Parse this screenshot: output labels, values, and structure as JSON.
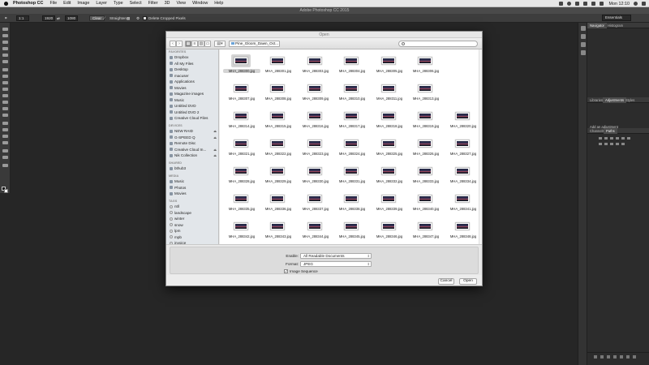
{
  "menubar": {
    "app_name": "Photoshop CC",
    "items": [
      "File",
      "Edit",
      "Image",
      "Layer",
      "Type",
      "Select",
      "Filter",
      "3D",
      "View",
      "Window",
      "Help"
    ],
    "clock": "Mon 12:10"
  },
  "ps": {
    "window_title": "Adobe Photoshop CC 2015",
    "options": {
      "ratio_value": "1:1",
      "width_value": "1920",
      "height_value": "1080",
      "clear_label": "Clear",
      "straighten_label": "Straighten",
      "delete_cropped_label": "Delete Cropped Pixels"
    },
    "workspace": "Essentials"
  },
  "panels": {
    "top_tabs": [
      "Navigator",
      "Histogram"
    ],
    "mid_tabs": [
      "Libraries",
      "Adjustments",
      "Styles"
    ],
    "add_adjustment": "Add an adjustment",
    "bottom_tabs": [
      "Channels",
      "Paths"
    ]
  },
  "dialog": {
    "title": "Open",
    "folder": "Pine_Gloom_Dawn_Oct...",
    "sidebar": {
      "favorites_header": "FAVORITES",
      "favorites": [
        "Dropbox",
        "All My Files",
        "Desktop",
        "macuser",
        "Applications",
        "Movies",
        "Magazine images",
        "Music",
        "Untitled DVD",
        "Untitled DVD 2",
        "Creative Cloud Files"
      ],
      "devices_header": "DEVICES",
      "devices": [
        "NEW RAID",
        "G-SPEED Q",
        "Remote Disc",
        "Creative Cloud In...",
        "Nik Collection"
      ],
      "shared_header": "SHARED",
      "shared": [
        "bthub3"
      ],
      "media_header": "MEDIA",
      "media": [
        "Music",
        "Photos",
        "Movies"
      ],
      "tags_header": "TAGS",
      "tags": [
        "ntll",
        "landscape",
        "winter",
        "snow",
        "lpm",
        "mpb",
        "invoice"
      ]
    },
    "files": [
      "MHA_288300.jpg",
      "MHA_288301.jpg",
      "MHA_288303.jpg",
      "MHA_288304.jpg",
      "MHA_288305.jpg",
      "MHA_288306.jpg",
      "MHA_288307.jpg",
      "MHA_288308.jpg",
      "MHA_288309.jpg",
      "MHA_288310.jpg",
      "MHA_288311.jpg",
      "MHA_288313.jpg",
      "MHA_288314.jpg",
      "MHA_288315.jpg",
      "MHA_288316.jpg",
      "MHA_288317.jpg",
      "MHA_288318.jpg",
      "MHA_288319.jpg",
      "MHA_288320.jpg",
      "MHA_288321.jpg",
      "MHA_288322.jpg",
      "MHA_288323.jpg",
      "MHA_288324.jpg",
      "MHA_288325.jpg",
      "MHA_288326.jpg",
      "MHA_288327.jpg",
      "MHA_288328.jpg",
      "MHA_288329.jpg",
      "MHA_288330.jpg",
      "MHA_288331.jpg",
      "MHA_288332.jpg",
      "MHA_288333.jpg",
      "MHA_288334.jpg",
      "MHA_288335.jpg",
      "MHA_288336.jpg",
      "MHA_288337.jpg",
      "MHA_288338.jpg",
      "MHA_288339.jpg",
      "MHA_288340.jpg",
      "MHA_288341.jpg",
      "MHA_288342.jpg",
      "MHA_288343.jpg",
      "MHA_288344.jpg",
      "MHA_288345.jpg",
      "MHA_288346.jpg",
      "MHA_288347.jpg",
      "MHA_288348.jpg"
    ],
    "enable_label": "Enable:",
    "enable_value": "All Readable Documents",
    "format_label": "Format:",
    "format_value": "JPEG",
    "image_sequence_label": "Image Sequence",
    "image_sequence_checked": true,
    "cancel_label": "Cancel",
    "open_label": "Open"
  },
  "colors": {
    "workspace_bg": "#262626",
    "dialog_bg": "#ececec",
    "sidebar_bg": "#e2e6ea",
    "selection": "#d4d4d4"
  }
}
